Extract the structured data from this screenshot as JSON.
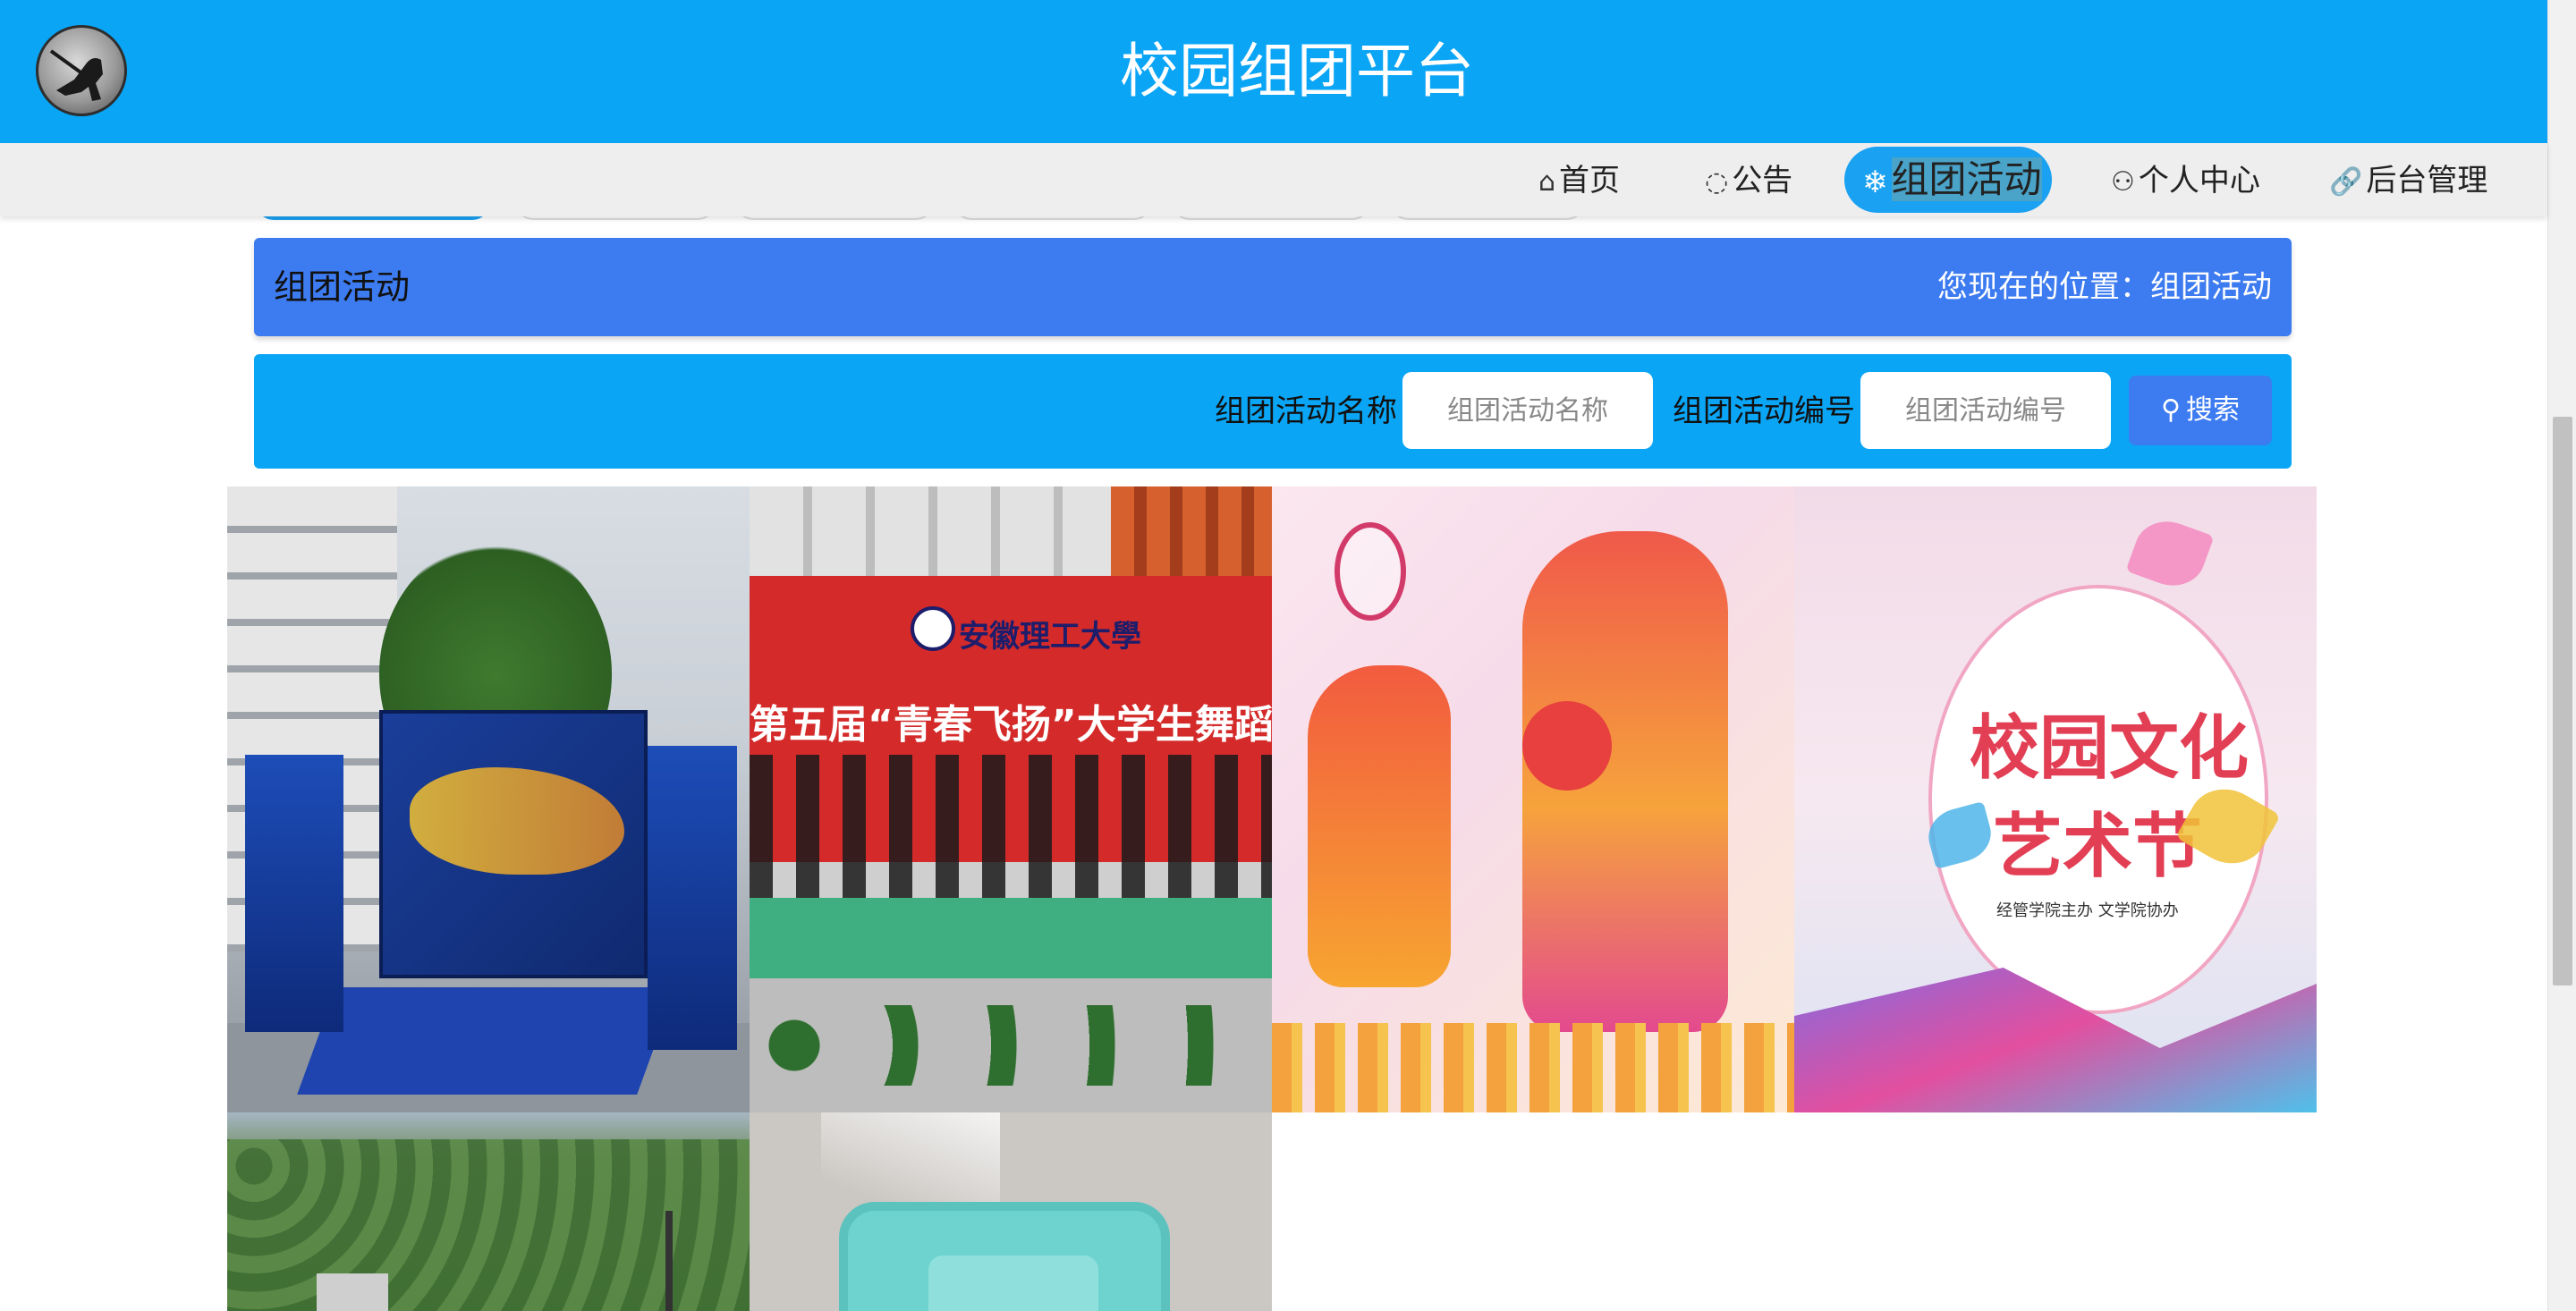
{
  "header": {
    "title": "校园组团平台"
  },
  "nav": {
    "home": "首页",
    "notice": "公告",
    "activity": "组团活动",
    "user_center": "个人中心",
    "admin": "后台管理"
  },
  "breadcrumb": {
    "title": "组团活动",
    "location_label": "您现在的位置：",
    "location_value": "组团活动"
  },
  "search": {
    "name_label": "组团活动名称",
    "name_placeholder": "组团活动名称",
    "name_value": "",
    "code_label": "组团活动编号",
    "code_placeholder": "组团活动编号",
    "code_value": "",
    "button_label": "搜索"
  },
  "gallery": {
    "cards": [
      {
        "image": "stage-promo-photo"
      },
      {
        "image": "dance-competition-photo",
        "text_uni": "安徽理工大學",
        "text_head": "第五届“青春飞扬”大学生舞蹈大"
      },
      {
        "image": "sports-poster"
      },
      {
        "image": "culture-festival-poster",
        "text_line1": "校园文化",
        "text_line2": "艺术节",
        "text_line3": "经管学院主办 文学院协办"
      },
      {
        "image": "green-hills-photo"
      },
      {
        "image": "plastic-basket-photo"
      }
    ]
  },
  "icons": {
    "home": "home-icon",
    "notice": "chat-icon",
    "activity": "snowflake-icon",
    "user": "user-icon",
    "admin": "link-icon",
    "search": "search-icon"
  },
  "colors": {
    "header_bg": "#0ba5f5",
    "nav_bg": "#eeeeee",
    "active_pill": "#1aa1f2",
    "crumb_bg": "#3d7bf0",
    "search_bg": "#0ba5f5",
    "search_button": "#3d7bf0"
  }
}
